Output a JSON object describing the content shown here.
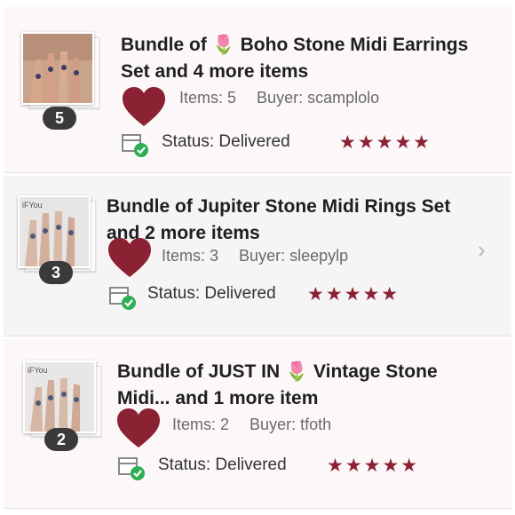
{
  "orders": [
    {
      "title_line1": "Bundle of 🌷 Boho Stone Midi Earrings",
      "title_line2": "Set and 4 more items",
      "count": "5",
      "items": "Items: 5",
      "buyer": "Buyer: scamplolo",
      "status": "Status:  Delivered",
      "stars": "★★★★★",
      "thumb_overlay": ""
    },
    {
      "title_line1": "Bundle of Jupiter Stone Midi Rings Set",
      "title_line2": "and 2 more items",
      "count": "3",
      "items": "Items: 3",
      "buyer": "Buyer: sleepylp",
      "status": "Status:  Delivered",
      "stars": "★★★★★",
      "thumb_overlay": "iFYou"
    },
    {
      "title_line1": "Bundle of JUST IN 🌷 Vintage Stone",
      "title_line2": "Midi... and 1 more item",
      "count": "2",
      "items": "Items: 2",
      "buyer": "Buyer: tfoth",
      "status": "Status:  Delivered",
      "stars": "★★★★★",
      "thumb_overlay": "iFYou"
    }
  ],
  "chevron": "›",
  "colors": {
    "heart": "#8a2233",
    "stars": "#8a2233",
    "check": "#2fae54",
    "badge": "#3a3a3a"
  }
}
